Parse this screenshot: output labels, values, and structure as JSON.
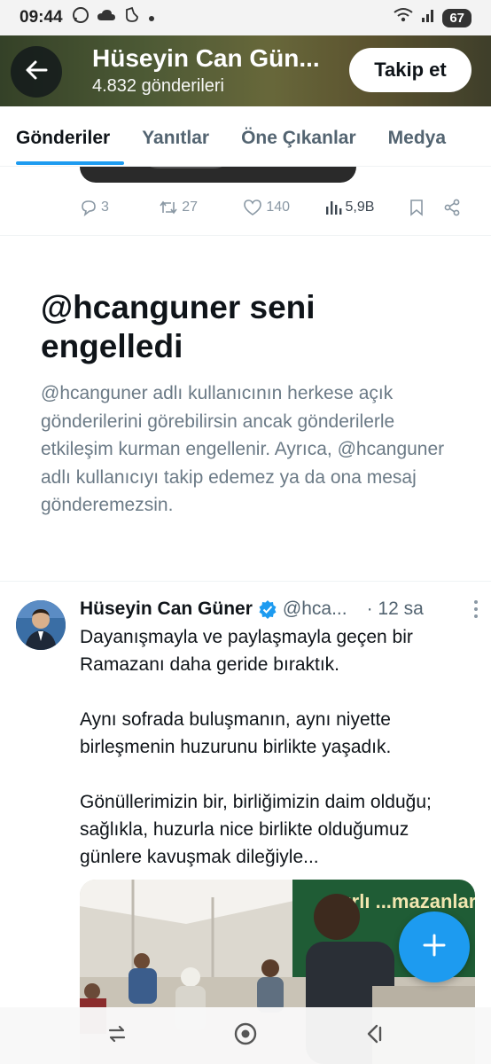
{
  "status_bar": {
    "time": "09:44",
    "battery": "67"
  },
  "header": {
    "name": "Hüseyin Can Gün...",
    "post_count": "4.832 gönderileri",
    "follow_label": "Takip et"
  },
  "tabs": [
    {
      "label": "Gönderiler"
    },
    {
      "label": "Yanıtlar"
    },
    {
      "label": "Öne Çıkanlar"
    },
    {
      "label": "Medya"
    }
  ],
  "previous_tweet": {
    "replies": "3",
    "reposts": "27",
    "likes": "140",
    "views": "5,9B"
  },
  "blocked": {
    "title": "@hcanguner seni engelledi",
    "body": "@hcanguner adlı kullanıcının herkese açık gönderilerini görebilirsin ancak gönderilerle etkileşim kurman engellenir. Ayrıca, @hcanguner adlı kullanıcıyı takip edemez ya da ona mesaj gönderemezsin."
  },
  "tweet": {
    "name": "Hüseyin Can Güner",
    "handle": "@hca...",
    "time": "· 12 sa",
    "paragraphs": [
      "Dayanışmayla ve paylaşmayla geçen bir Ramazanı daha geride bıraktık.",
      "Aynı sofrada buluşmanın, aynı niyette birleşmenin huzurunu birlikte yaşadık.",
      "Gönüllerimizin bir, birliğimizin daim olduğu; sağlıkla, huzurla nice birlikte olduğumuz günlere kavuşmak dileğiyle..."
    ],
    "media_banner": "...yırlı ...mazanlar"
  },
  "colors": {
    "accent": "#1d9bf0",
    "text_primary": "#0f1419",
    "text_secondary": "#536471"
  }
}
